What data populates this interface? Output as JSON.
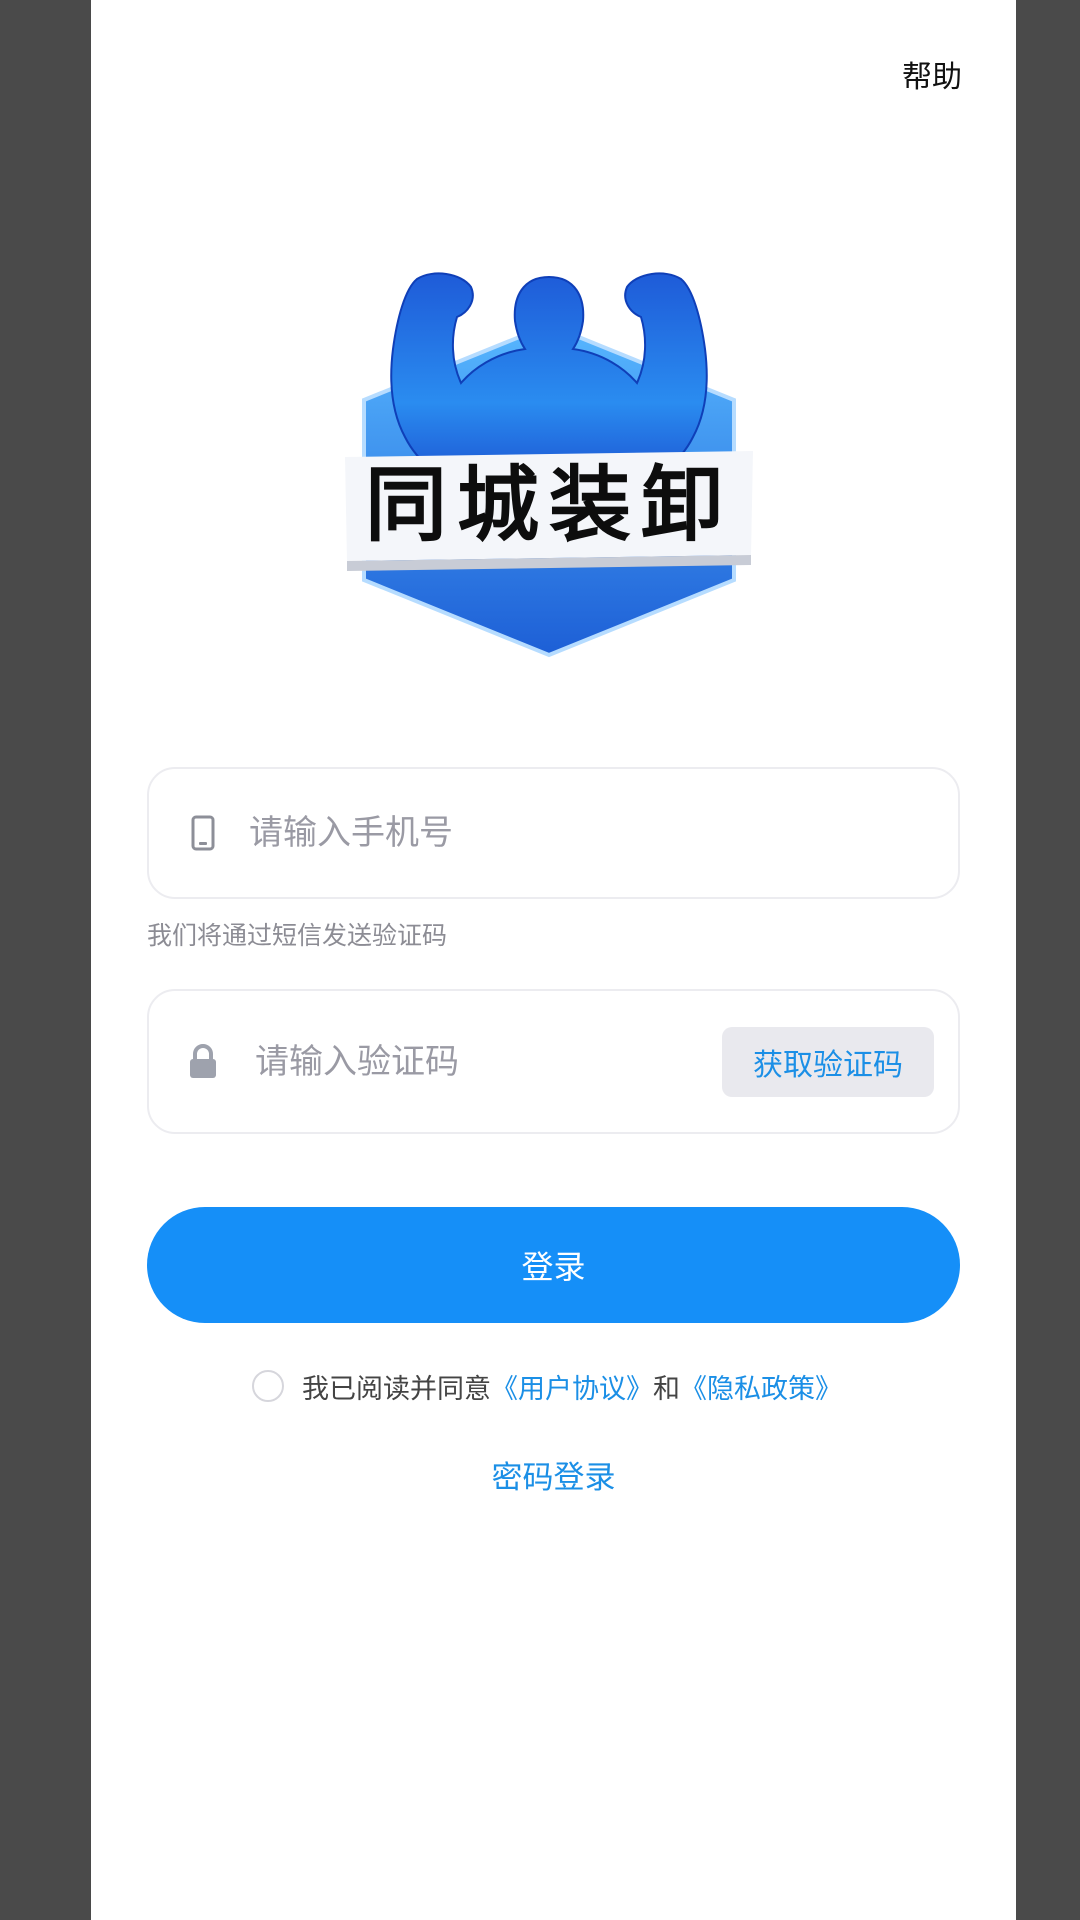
{
  "header": {
    "help_label": "帮助"
  },
  "logo": {
    "text": "同城装卸"
  },
  "phone": {
    "placeholder": "请输入手机号",
    "value": "",
    "hint": "我们将通过短信发送验证码"
  },
  "code": {
    "placeholder": "请输入验证码",
    "value": "",
    "get_code_label": "获取验证码"
  },
  "login": {
    "label": "登录"
  },
  "agreement": {
    "prefix": "我已阅读并同意",
    "user_agreement": "《用户协议》",
    "conjunction": "和",
    "privacy_policy": "《隐私政策》",
    "checked": false
  },
  "password_login": {
    "label": "密码登录"
  },
  "icons": {
    "phone": "phone-icon",
    "lock": "lock-icon"
  },
  "colors": {
    "accent": "#158ff8",
    "link": "#1b8fe6",
    "background": "#ffffff",
    "frame": "#4a4a4a"
  }
}
